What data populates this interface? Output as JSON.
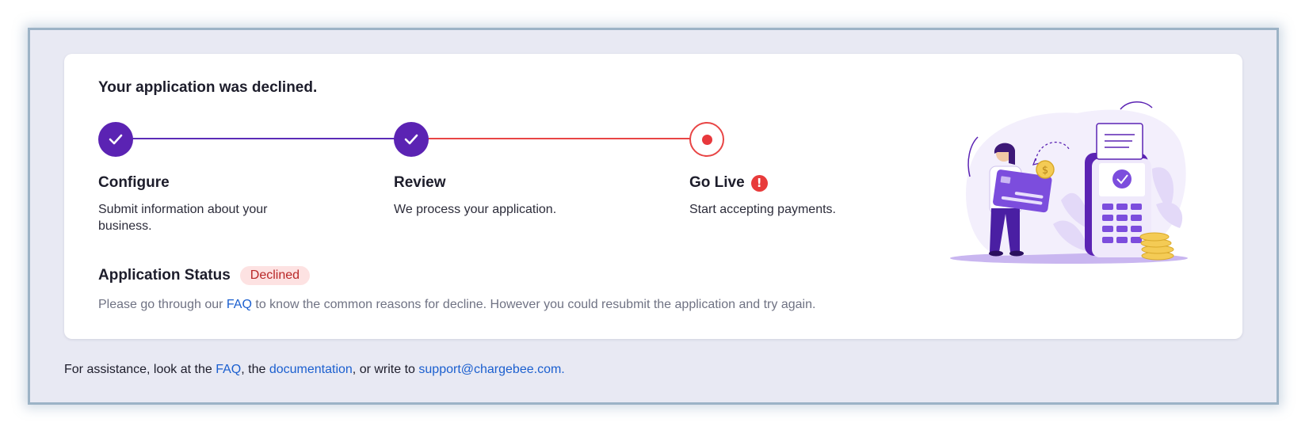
{
  "card": {
    "title": "Your application was declined."
  },
  "steps": [
    {
      "label": "Configure",
      "description": "Submit information about your business.",
      "state": "complete"
    },
    {
      "label": "Review",
      "description": "We process your application.",
      "state": "complete"
    },
    {
      "label": "Go Live",
      "description": "Start accepting payments.",
      "state": "current-error"
    }
  ],
  "alert_icon": "exclamation-circle-icon",
  "status": {
    "label": "Application Status",
    "badge": "Declined",
    "note_prefix": "Please go through our",
    "note_link": "FAQ",
    "note_suffix": "to know the common reasons for decline. However you could resubmit the application and try again."
  },
  "footer": {
    "text_1": "For assistance, look at the",
    "link_faq": "FAQ",
    "text_2": ", the",
    "link_docs": "documentation",
    "text_3": ", or write to",
    "link_email": "support@chargebee.com."
  },
  "colors": {
    "accent": "#5b23b3",
    "error": "#e84545",
    "link": "#1b5fcf",
    "badge_bg": "#fde2e2",
    "badge_text": "#b92828"
  }
}
